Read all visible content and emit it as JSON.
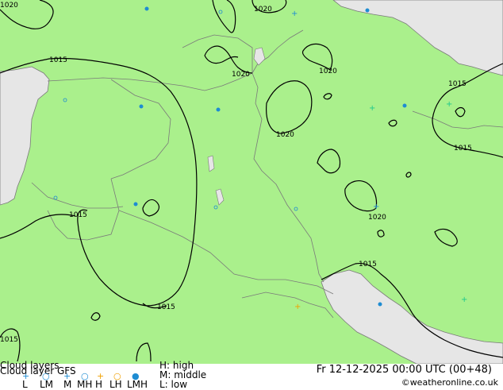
{
  "map": {
    "colors": {
      "land": "#aaf08c",
      "sea": "#e6e6e6",
      "border": "#7a7a7a",
      "isobar": "#000000",
      "grid": "#9aaa9a"
    },
    "isobar_labels": [
      {
        "text": "1020"
      },
      {
        "text": "1015"
      },
      {
        "text": "1020"
      },
      {
        "text": "1020"
      },
      {
        "text": "1015"
      },
      {
        "text": "1020"
      },
      {
        "text": "1015"
      },
      {
        "text": "1015"
      },
      {
        "text": "1020"
      },
      {
        "text": "1015"
      },
      {
        "text": "1015"
      },
      {
        "text": "1015"
      },
      {
        "text": "1020"
      }
    ]
  },
  "legend": {
    "title": "Cloud layer GFS",
    "title_overlay": "Cloud layers",
    "symbols": [
      {
        "label": "L",
        "glyph": "+",
        "color": "#1e8cd2"
      },
      {
        "label": "LM",
        "glyph": "○",
        "color": "#1e8cd2"
      },
      {
        "label": "M",
        "glyph": "+",
        "color": "#1e8cd2"
      },
      {
        "label": "MH",
        "glyph": "○",
        "color": "#1e8cd2"
      },
      {
        "label": "H",
        "glyph": "+",
        "color": "#f0a000"
      },
      {
        "label": "LH",
        "glyph": "○",
        "color": "#f0a000"
      },
      {
        "label": "LMH",
        "glyph": "●",
        "color": "#1e8cd2"
      }
    ],
    "key": {
      "high": "H: high",
      "middle": "M: middle",
      "low": "L: low"
    },
    "datetime": "Fr 12-12-2025 00:00 UTC (00+48)",
    "credit": "©weatheronline.co.uk"
  }
}
